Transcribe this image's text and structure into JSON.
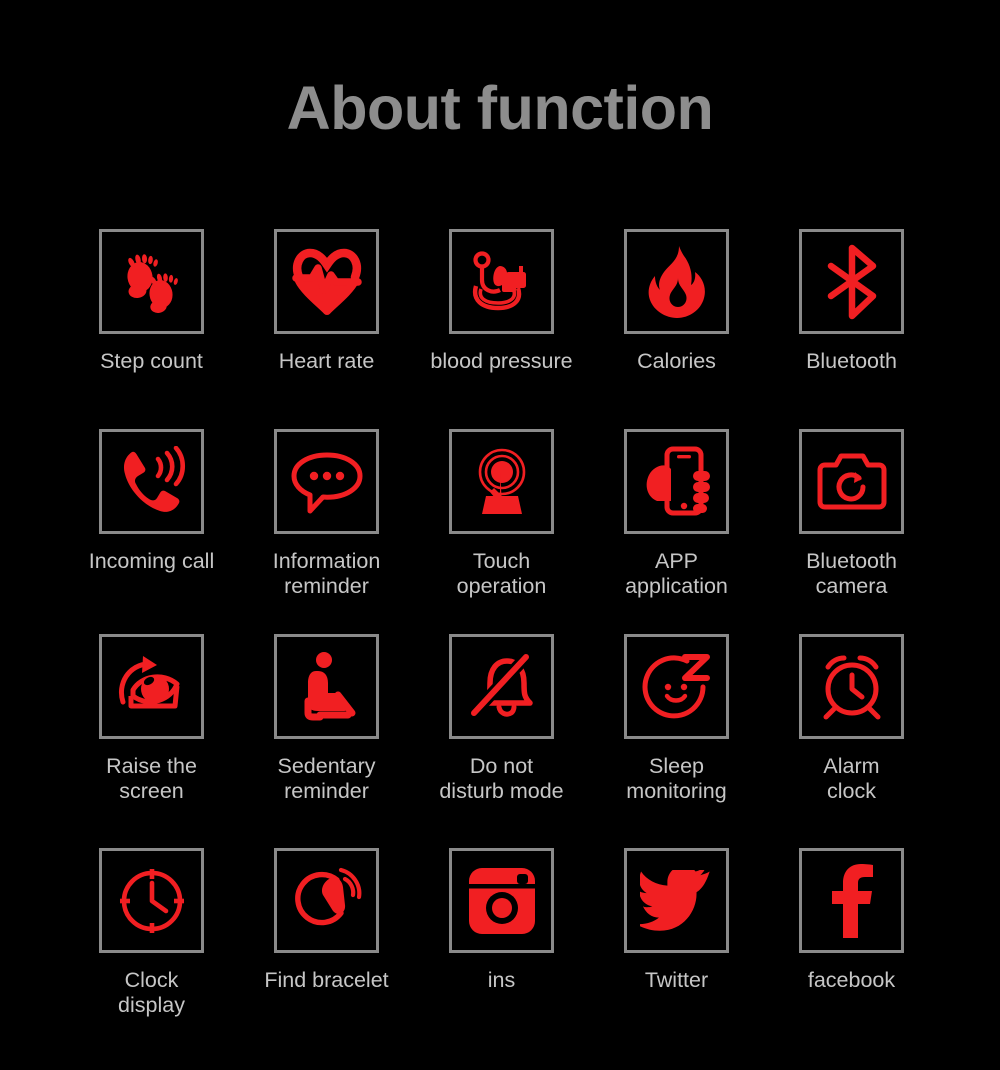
{
  "header": {
    "title": "About function"
  },
  "theme": {
    "background": "#000000",
    "icon_red": "#f11f22",
    "box_border_gray": "#8a8a8a",
    "label_gray": "#c6c6c6",
    "title_gray": "#8d8d8d"
  },
  "grid": {
    "columns": 5,
    "rows": [
      {
        "cells": [
          {
            "label": "Step count",
            "icon": "footprints-icon"
          },
          {
            "label": "Heart rate",
            "icon": "heart-pulse-icon"
          },
          {
            "label": "blood pressure",
            "icon": "blood-pressure-monitor-icon"
          },
          {
            "label": "Calories",
            "icon": "flame-icon"
          },
          {
            "label": "Bluetooth",
            "icon": "bluetooth-icon"
          }
        ]
      },
      {
        "cells": [
          {
            "label": "Incoming call",
            "icon": "ringing-phone-icon"
          },
          {
            "label": "Information\nreminder",
            "icon": "speech-bubble-icon"
          },
          {
            "label": "Touch\noperation",
            "icon": "touch-tap-icon"
          },
          {
            "label": "APP\napplication",
            "icon": "hand-phone-icon"
          },
          {
            "label": "Bluetooth\ncamera",
            "icon": "camera-icon"
          }
        ]
      },
      {
        "cells": [
          {
            "label": "Raise the\nscreen",
            "icon": "raise-wrist-eye-icon"
          },
          {
            "label": "Sedentary\nreminder",
            "icon": "seated-person-icon"
          },
          {
            "label": "Do not\ndisturb mode",
            "icon": "bell-slash-icon"
          },
          {
            "label": "Sleep\nmonitoring",
            "icon": "sleep-face-icon"
          },
          {
            "label": "Alarm\nclock",
            "icon": "alarm-clock-icon"
          }
        ]
      },
      {
        "cells": [
          {
            "label": "Clock\ndisplay",
            "icon": "clock-dial-icon"
          },
          {
            "label": "Find bracelet",
            "icon": "find-bracelet-icon"
          },
          {
            "label": "ins",
            "icon": "instagram-icon"
          },
          {
            "label": "Twitter",
            "icon": "twitter-bird-icon"
          },
          {
            "label": "facebook",
            "icon": "facebook-f-icon"
          }
        ]
      }
    ]
  }
}
